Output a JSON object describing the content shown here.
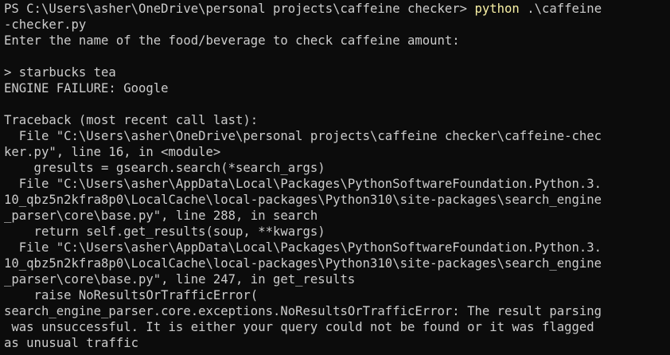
{
  "terminal": {
    "lines": {
      "l0_prompt": "PS C:\\Users\\asher\\OneDrive\\personal projects\\caffeine checker> ",
      "l0_cmd": "python",
      "l0_args": " .\\caffeine",
      "l1": "-checker.py",
      "l2": "Enter the name of the food/beverage to check caffeine amount:",
      "l3": "",
      "l4": "> starbucks tea",
      "l5": "ENGINE FAILURE: Google",
      "l6": "",
      "l7": "Traceback (most recent call last):",
      "l8": "  File \"C:\\Users\\asher\\OneDrive\\personal projects\\caffeine checker\\caffeine-chec",
      "l9": "ker.py\", line 16, in <module>",
      "l10": "    gresults = gsearch.search(*search_args)",
      "l11": "  File \"C:\\Users\\asher\\AppData\\Local\\Packages\\PythonSoftwareFoundation.Python.3.",
      "l12": "10_qbz5n2kfra8p0\\LocalCache\\local-packages\\Python310\\site-packages\\search_engine",
      "l13": "_parser\\core\\base.py\", line 288, in search",
      "l14": "    return self.get_results(soup, **kwargs)",
      "l15": "  File \"C:\\Users\\asher\\AppData\\Local\\Packages\\PythonSoftwareFoundation.Python.3.",
      "l16": "10_qbz5n2kfra8p0\\LocalCache\\local-packages\\Python310\\site-packages\\search_engine",
      "l17": "_parser\\core\\base.py\", line 247, in get_results",
      "l18": "    raise NoResultsOrTrafficError(",
      "l19": "search_engine_parser.core.exceptions.NoResultsOrTrafficError: The result parsing",
      "l20": " was unsuccessful. It is either your query could not be found or it was flagged",
      "l21": "as unusual traffic"
    }
  },
  "colors": {
    "background": "#0c0c0c",
    "text": "#cccccc",
    "command": "#f9f1a5"
  }
}
